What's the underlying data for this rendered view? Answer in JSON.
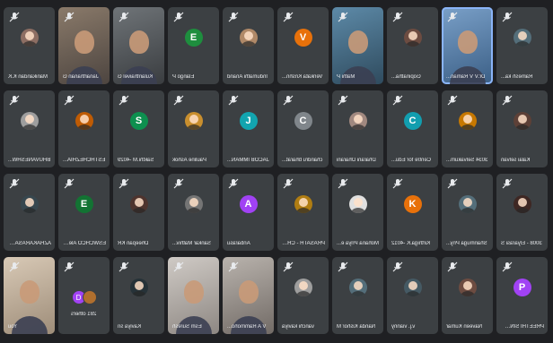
{
  "rows": [
    [
      {
        "name": "Manikandan K.K",
        "avatar": "photo",
        "color": "#8d6e63",
        "speaking": false,
        "video": false
      },
      {
        "name": "Janarthanan G",
        "avatar": "",
        "color": "",
        "speaking": false,
        "video": true,
        "v": "v1"
      },
      {
        "name": "Kulanthaivel G",
        "avatar": "",
        "color": "",
        "speaking": false,
        "video": true,
        "v": "v2"
      },
      {
        "name": "Elango P",
        "avatar": "E",
        "color": "#1e8e3e",
        "speaking": false,
        "video": false
      },
      {
        "name": "Indumathi Anand",
        "avatar": "photo",
        "color": "#b08968",
        "speaking": false,
        "video": false
      },
      {
        "name": "Venkata Krishn...",
        "avatar": "V",
        "color": "#e8710a",
        "speaking": false,
        "video": false
      },
      {
        "name": "Mathi P",
        "avatar": "",
        "color": "",
        "speaking": false,
        "video": true,
        "v": "v3"
      },
      {
        "name": "Gopinatha...",
        "avatar": "photo",
        "color": "#6d4c41",
        "speaking": false,
        "video": false
      },
      {
        "name": "Dr.V V Raman...",
        "avatar": "",
        "color": "",
        "speaking": true,
        "video": true,
        "v": "v6"
      },
      {
        "name": "Ramesh ka...",
        "avatar": "photo",
        "color": "#546e7a",
        "speaking": false,
        "video": false
      }
    ],
    [
      {
        "name": "BHUVANESHW...",
        "avatar": "photo",
        "color": "#9e9e9e",
        "speaking": false,
        "video": false
      },
      {
        "name": "ESTHCHEZHIA...",
        "avatar": "photo",
        "color": "#bf5b04",
        "speaking": false,
        "video": false
      },
      {
        "name": "Sakthi.M -4029",
        "avatar": "S",
        "color": "#0d904f",
        "speaking": false,
        "video": false
      },
      {
        "name": "Pauline Ashok",
        "avatar": "photo",
        "color": "#c98f2e",
        "speaking": false,
        "video": false
      },
      {
        "name": "JACOB IMMAN...",
        "avatar": "J",
        "color": "#12a4af",
        "speaking": false,
        "video": false
      },
      {
        "name": "chandru bharat...",
        "avatar": "C",
        "color": "#80868b",
        "speaking": false,
        "video": false
      },
      {
        "name": "Dharani Dharani",
        "avatar": "photo",
        "color": "#a1887f",
        "speaking": false,
        "video": false
      },
      {
        "name": "Centre for Edu...",
        "avatar": "C",
        "color": "#129eaf",
        "speaking": false,
        "video": false
      },
      {
        "name": "3034 Selvakum...",
        "avatar": "photo",
        "color": "#c77800",
        "speaking": false,
        "video": false
      },
      {
        "name": "Kalai selvan",
        "avatar": "photo",
        "color": "#5d4037",
        "speaking": false,
        "video": false
      }
    ],
    [
      {
        "name": "AZHAKARASAN...",
        "avatar": "photo",
        "color": "#37474f",
        "speaking": false,
        "video": false
      },
      {
        "name": "ESWCHCO Alex...",
        "avatar": "E",
        "color": "#137333",
        "speaking": false,
        "video": false
      },
      {
        "name": "Dheepan KR",
        "avatar": "photo",
        "color": "#4e342e",
        "speaking": false,
        "video": false
      },
      {
        "name": "Sankar Mathiv...",
        "avatar": "photo",
        "color": "#757575",
        "speaking": false,
        "video": false
      },
      {
        "name": "Anbarasu",
        "avatar": "A",
        "color": "#a142f4",
        "speaking": false,
        "video": false
      },
      {
        "name": "PRASATH - CHE...",
        "avatar": "photo",
        "color": "#b07d12",
        "speaking": false,
        "video": false
      },
      {
        "name": "Mohana Priya e...",
        "avatar": "photo",
        "color": "#e0e0e0",
        "speaking": false,
        "video": false
      },
      {
        "name": "Kirthiga.K -4012",
        "avatar": "K",
        "color": "#e8710a",
        "speaking": false,
        "video": false
      },
      {
        "name": "Shanmuga Priy...",
        "avatar": "photo",
        "color": "#546e7a",
        "speaking": false,
        "video": false
      },
      {
        "name": "3008 - Elyarasi S",
        "avatar": "photo",
        "color": "#3e2723",
        "speaking": false,
        "video": false
      }
    ],
    [
      {
        "name": "You",
        "avatar": "",
        "color": "",
        "speaking": false,
        "video": true,
        "v": "v7"
      },
      {
        "name": "others",
        "avatar": "others",
        "color": "",
        "speaking": false,
        "video": false,
        "count": "281 others",
        "o1": "D",
        "o1c": "#a142f4",
        "o2": "",
        "o2c": "#b06f2e"
      },
      {
        "name": "Kaviya sri",
        "avatar": "photo",
        "color": "#263238",
        "speaking": false,
        "video": false
      },
      {
        "name": "Esm Suresh",
        "avatar": "",
        "color": "",
        "speaking": false,
        "video": true,
        "v": "v5"
      },
      {
        "name": "V A Rammoho...",
        "avatar": "",
        "color": "",
        "speaking": false,
        "video": true,
        "v": "v4"
      },
      {
        "name": "vanchi kaviya",
        "avatar": "photo",
        "color": "#9e9e9e",
        "speaking": false,
        "video": false
      },
      {
        "name": "Nanda Kishor M",
        "avatar": "photo",
        "color": "#546e7a",
        "speaking": false,
        "video": false
      },
      {
        "name": "v.j. vianny",
        "avatar": "photo",
        "color": "#455a64",
        "speaking": false,
        "video": false
      },
      {
        "name": "Naveen Kumar",
        "avatar": "photo",
        "color": "#6d4c41",
        "speaking": false,
        "video": false
      },
      {
        "name": "PREETHI SINDHU",
        "avatar": "P",
        "color": "#a142f4",
        "speaking": false,
        "video": false
      }
    ]
  ]
}
